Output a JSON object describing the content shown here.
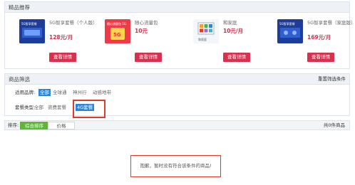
{
  "recommend": {
    "title": "精品推荐",
    "products": [
      {
        "name": "5G智享套餐（个人版）",
        "price": "128元/月",
        "button": "查看详情"
      },
      {
        "name": "随心流量包",
        "price": "10元",
        "button": "查看详情"
      },
      {
        "name": "和家庭",
        "price": "10元/月",
        "button": "查看详情"
      },
      {
        "name": "5G智享套餐（家庭版）",
        "price": "169元/月",
        "button": "查看详情"
      }
    ],
    "thumb_texts": [
      "5G智享套餐",
      "随心流量包 5G",
      "5G",
      "和家庭",
      "5G智享套餐"
    ]
  },
  "filter": {
    "title": "商品筛选",
    "reset": "重置筛选条件",
    "brand_label": "适用品牌:",
    "brands": [
      "全部",
      "全球通",
      "神州行",
      "动感地带"
    ],
    "package_label": "套餐类型:",
    "packages": [
      "全部",
      "资费套餐",
      "4G套餐"
    ]
  },
  "sort": {
    "label": "排序:",
    "tabs": [
      "综合排序",
      "价格"
    ],
    "total": "共0件商品"
  },
  "empty_message": "抱歉，暂时没有符合该条件的商品!",
  "colors": {
    "accent_red": "#d9304f",
    "selected_blue": "#2a86d8",
    "sort_green": "#5fb53a",
    "highlight_red": "#e2392b"
  }
}
